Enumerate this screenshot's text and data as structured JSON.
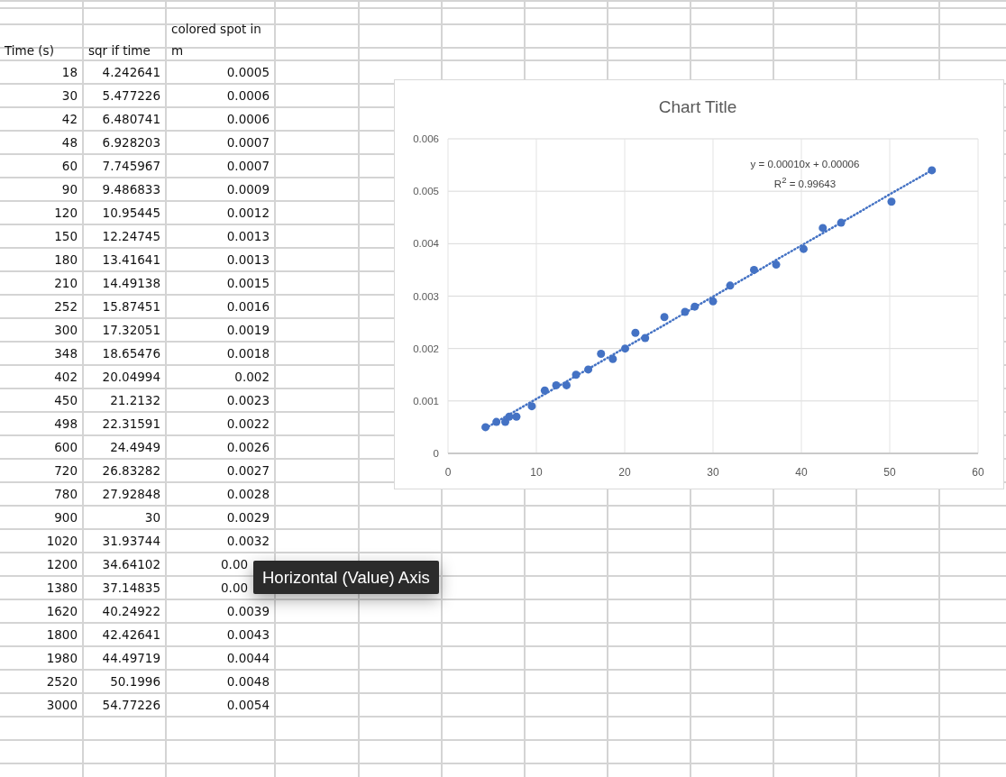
{
  "sheet": {
    "columns": [
      {
        "label": "Time (s)"
      },
      {
        "label": "sqr if time"
      },
      {
        "label": "colored spot in m"
      }
    ],
    "rows": [
      {
        "cells": [
          "18",
          "4.242641",
          "0.0005"
        ],
        "covered": false
      },
      {
        "cells": [
          "30",
          "5.477226",
          "0.0006"
        ],
        "covered": false
      },
      {
        "cells": [
          "42",
          "6.480741",
          "0.0006"
        ],
        "covered": false
      },
      {
        "cells": [
          "48",
          "6.928203",
          "0.0007"
        ],
        "covered": false
      },
      {
        "cells": [
          "60",
          "7.745967",
          "0.0007"
        ],
        "covered": false
      },
      {
        "cells": [
          "90",
          "9.486833",
          "0.0009"
        ],
        "covered": false
      },
      {
        "cells": [
          "120",
          "10.95445",
          "0.0012"
        ],
        "covered": false
      },
      {
        "cells": [
          "150",
          "12.24745",
          "0.0013"
        ],
        "covered": false
      },
      {
        "cells": [
          "180",
          "13.41641",
          "0.0013"
        ],
        "covered": false
      },
      {
        "cells": [
          "210",
          "14.49138",
          "0.0015"
        ],
        "covered": false
      },
      {
        "cells": [
          "252",
          "15.87451",
          "0.0016"
        ],
        "covered": false
      },
      {
        "cells": [
          "300",
          "17.32051",
          "0.0019"
        ],
        "covered": false
      },
      {
        "cells": [
          "348",
          "18.65476",
          "0.0018"
        ],
        "covered": false
      },
      {
        "cells": [
          "402",
          "20.04994",
          "0.002"
        ],
        "covered": false
      },
      {
        "cells": [
          "450",
          "21.2132",
          "0.0023"
        ],
        "covered": false
      },
      {
        "cells": [
          "498",
          "22.31591",
          "0.0022"
        ],
        "covered": false
      },
      {
        "cells": [
          "600",
          "24.4949",
          "0.0026"
        ],
        "covered": false
      },
      {
        "cells": [
          "720",
          "26.83282",
          "0.0027"
        ],
        "covered": false
      },
      {
        "cells": [
          "780",
          "27.92848",
          "0.0028"
        ],
        "covered": false
      },
      {
        "cells": [
          "900",
          "30",
          "0.0029"
        ],
        "covered": false
      },
      {
        "cells": [
          "1020",
          "31.93744",
          "0.0032"
        ],
        "covered": false
      },
      {
        "cells": [
          "1200",
          "34.64102",
          "0.00"
        ],
        "covered": true
      },
      {
        "cells": [
          "1380",
          "37.14835",
          "0.00"
        ],
        "covered": true
      },
      {
        "cells": [
          "1620",
          "40.24922",
          "0.0039"
        ],
        "covered": false
      },
      {
        "cells": [
          "1800",
          "42.42641",
          "0.0043"
        ],
        "covered": false
      },
      {
        "cells": [
          "1980",
          "44.49719",
          "0.0044"
        ],
        "covered": false
      },
      {
        "cells": [
          "2520",
          "50.1996",
          "0.0048"
        ],
        "covered": false
      },
      {
        "cells": [
          "3000",
          "54.77226",
          "0.0054"
        ],
        "covered": false
      }
    ]
  },
  "chart": {
    "chart_data": {
      "type": "scatter",
      "title": "Chart Title",
      "x": [
        4.242641,
        5.477226,
        6.480741,
        6.928203,
        7.745967,
        9.486833,
        10.95445,
        12.24745,
        13.41641,
        14.49138,
        15.87451,
        17.32051,
        18.65476,
        20.04994,
        21.2132,
        22.31591,
        24.4949,
        26.83282,
        27.92848,
        30,
        31.93744,
        34.64102,
        37.14835,
        40.24922,
        42.42641,
        44.49719,
        50.1996,
        54.77226
      ],
      "series": [
        {
          "color": "#4472c4",
          "values": [
            0.0005,
            0.0006,
            0.0006,
            0.0007,
            0.0007,
            0.0009,
            0.0012,
            0.0013,
            0.0013,
            0.0015,
            0.0016,
            0.0019,
            0.0018,
            0.002,
            0.0023,
            0.0022,
            0.0026,
            0.0027,
            0.0028,
            0.0029,
            0.0032,
            0.0035,
            0.0036,
            0.0039,
            0.0043,
            0.0044,
            0.0048,
            0.0054
          ]
        },
        {
          "type": "line",
          "line_style": "dotted",
          "color": "#4472c4",
          "values": [
            0.00048,
            0.0006,
            0.0007,
            0.00074,
            0.00082,
            0.00099,
            0.00113,
            0.00126,
            0.00137,
            0.00148,
            0.00161,
            0.00175,
            0.00188,
            0.00202,
            0.00213,
            0.00224,
            0.00245,
            0.00268,
            0.00279,
            0.00299,
            0.00318,
            0.00344,
            0.00369,
            0.00399,
            0.0042,
            0.0044,
            0.00496,
            0.0054
          ]
        }
      ],
      "xlim": [
        0,
        60
      ],
      "ylim": [
        0,
        0.006
      ],
      "xticks": [
        0,
        10,
        20,
        30,
        40,
        50,
        60
      ],
      "yticks": [
        0,
        0.001,
        0.002,
        0.003,
        0.004,
        0.005,
        0.006
      ],
      "grid": true,
      "annotations": [
        "y = 0.00010x + 0.00006",
        "R$^{2}$ = 0.99643"
      ]
    }
  },
  "tooltip": {
    "text": "Horizontal (Value) Axis"
  }
}
